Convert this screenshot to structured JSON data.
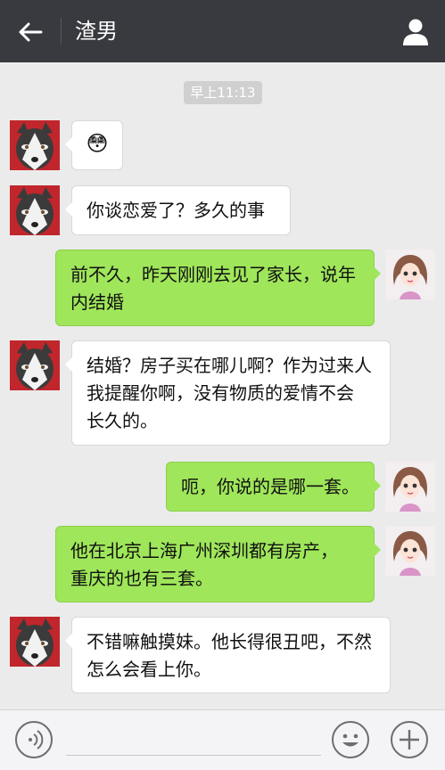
{
  "header": {
    "title": "渣男",
    "back_icon": "arrow-left-icon",
    "profile_icon": "person-icon"
  },
  "timestamp": "早上11:13",
  "messages": [
    {
      "side": "left",
      "type": "emoji",
      "emoji": "😳"
    },
    {
      "side": "left",
      "text": "你谈恋爱了？多久的事"
    },
    {
      "side": "right",
      "line1": "前不久，昨天刚刚去见了家长，说年",
      "line2": "内结婚"
    },
    {
      "side": "left",
      "line1": "结婚？房子买在哪儿啊？作为过来人",
      "line2": "我提醒你啊，没有物质的爱情不会",
      "line3": "长久的。"
    },
    {
      "side": "right",
      "text": "呃，你说的是哪一套。"
    },
    {
      "side": "right",
      "line1": "他在北京上海广州深圳都有房产，",
      "line2": "重庆的也有三套。"
    },
    {
      "side": "left",
      "line1": "不错嘛触摸妹。他长得很丑吧，不然",
      "line2": "怎么会看上你。"
    }
  ],
  "bottom": {
    "voice_icon": "voice-icon",
    "emoji_icon": "smiley-icon",
    "plus_icon": "plus-icon"
  },
  "colors": {
    "topbar": "#393a3f",
    "background": "#ebebeb",
    "bubble_right": "#9fe65a",
    "bubble_left": "#ffffff"
  }
}
